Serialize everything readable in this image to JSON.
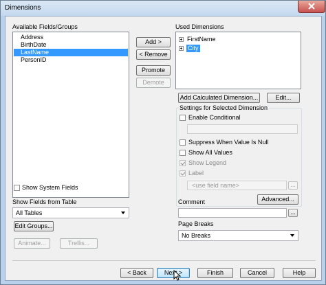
{
  "window": {
    "title": "Dimensions"
  },
  "available": {
    "label": "Available Fields/Groups",
    "items": [
      "Address",
      "BirthDate",
      "LastName",
      "PersonID"
    ],
    "selected_index": 2
  },
  "middle_buttons": {
    "add": "Add >",
    "remove": "< Remove",
    "promote": "Promote",
    "demote": "Demote"
  },
  "used": {
    "label": "Used Dimensions",
    "items": [
      {
        "label": "FirstName",
        "selected": false
      },
      {
        "label": "City",
        "selected": true
      }
    ]
  },
  "used_buttons": {
    "add_calculated": "Add Calculated Dimension...",
    "edit": "Edit..."
  },
  "settings": {
    "title": "Settings for Selected Dimension",
    "enable_conditional": {
      "label": "Enable Conditional",
      "checked": false
    },
    "suppress_null": {
      "label": "Suppress When Value Is Null",
      "checked": false
    },
    "show_all_values": {
      "label": "Show All Values",
      "checked": false
    },
    "show_legend": {
      "label": "Show Legend",
      "checked": true,
      "disabled": true
    },
    "label_check": {
      "label": "Label",
      "checked": true,
      "disabled": true
    },
    "label_field_placeholder": "<use field name>",
    "ellipsis": "...",
    "advanced": "Advanced...",
    "comment_label": "Comment",
    "page_breaks_label": "Page Breaks",
    "page_breaks_value": "No Breaks"
  },
  "left_bottom": {
    "show_system_fields": {
      "label": "Show System Fields",
      "checked": false
    },
    "show_fields_from_table_label": "Show Fields from Table",
    "table_value": "All Tables",
    "edit_groups": "Edit Groups...",
    "animate": "Animate...",
    "trellis": "Trellis..."
  },
  "footer": {
    "back": "< Back",
    "next": "Next >",
    "finish": "Finish",
    "cancel": "Cancel",
    "help": "Help"
  },
  "icons": {
    "close": "close-icon",
    "expander": "plus-box-icon",
    "dropdown": "chevron-down-icon",
    "cursor": "mouse-pointer-icon"
  },
  "colors": {
    "selection": "#3399ff",
    "titlebar": "#c4d8ee",
    "close_button": "#c75050",
    "dialog_bg": "#f0f0f0"
  }
}
